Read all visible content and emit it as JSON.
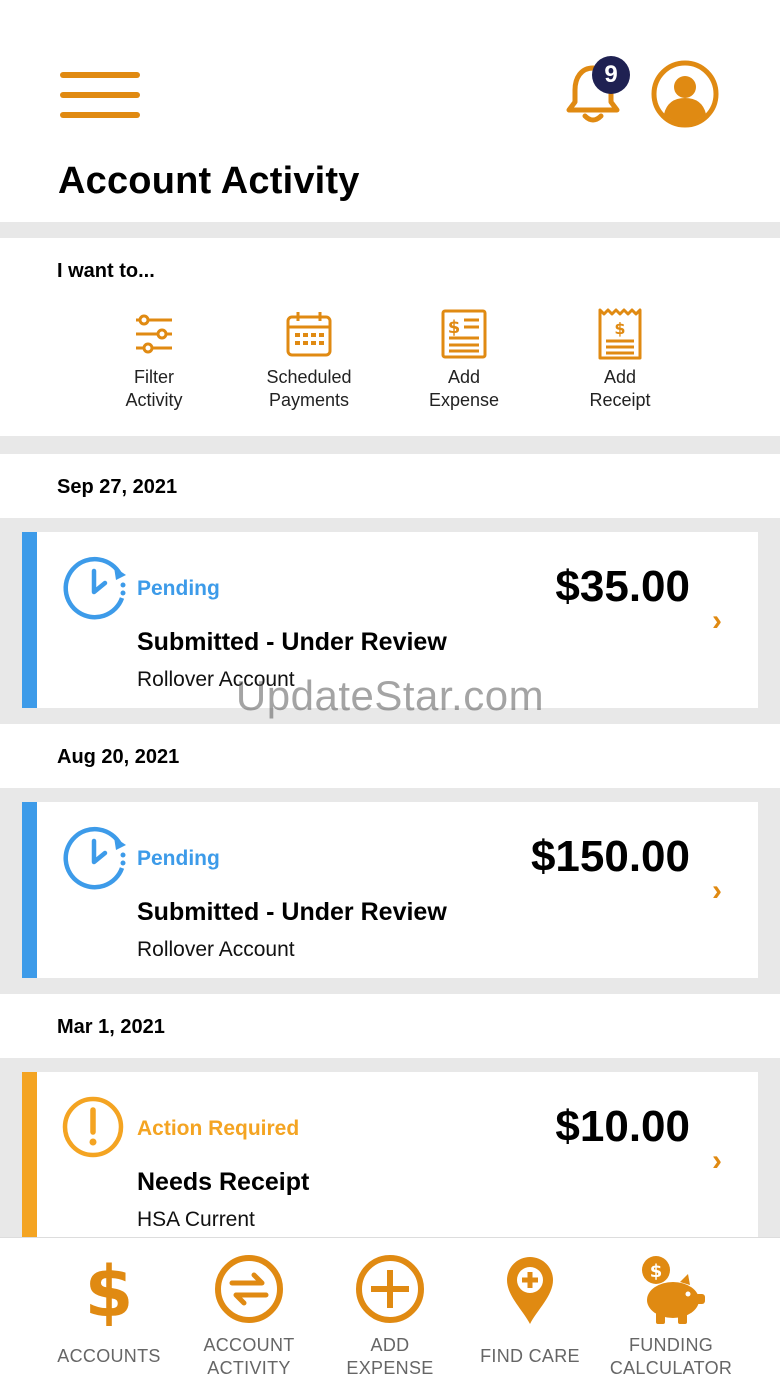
{
  "header": {
    "title": "Account Activity",
    "notification_count": "9"
  },
  "colors": {
    "accent": "#e08a12",
    "pending": "#3d9be9",
    "action_required": "#f4a422",
    "badge": "#1f2152"
  },
  "quick_actions": {
    "title": "I want to...",
    "items": [
      {
        "label": "Filter\nActivity",
        "icon": "filter-sliders-icon"
      },
      {
        "label": "Scheduled\nPayments",
        "icon": "calendar-icon"
      },
      {
        "label": "Add\nExpense",
        "icon": "expense-document-icon"
      },
      {
        "label": "Add\nReceipt",
        "icon": "receipt-icon"
      }
    ]
  },
  "activity": [
    {
      "date": "Sep 27, 2021",
      "status": "Pending",
      "amount": "$35.00",
      "title": "Submitted - Under Review",
      "account": "Rollover Account",
      "icon": "pending-clock-icon"
    },
    {
      "date": "Aug 20, 2021",
      "status": "Pending",
      "amount": "$150.00",
      "title": "Submitted - Under Review",
      "account": "Rollover Account",
      "icon": "pending-clock-icon"
    },
    {
      "date": "Mar 1, 2021",
      "status": "Action Required",
      "amount": "$10.00",
      "title": "Needs Receipt",
      "account": "HSA Current",
      "icon": "alert-icon"
    }
  ],
  "watermark": "UpdateStar.com",
  "tabbar": [
    {
      "label": "ACCOUNTS",
      "icon": "dollar-icon"
    },
    {
      "label": "ACCOUNT\nACTIVITY",
      "icon": "transfer-arrows-icon"
    },
    {
      "label": "ADD\nEXPENSE",
      "icon": "plus-circle-icon"
    },
    {
      "label": "FIND CARE",
      "icon": "map-pin-plus-icon"
    },
    {
      "label": "FUNDING\nCALCULATOR",
      "icon": "piggy-bank-icon"
    }
  ]
}
